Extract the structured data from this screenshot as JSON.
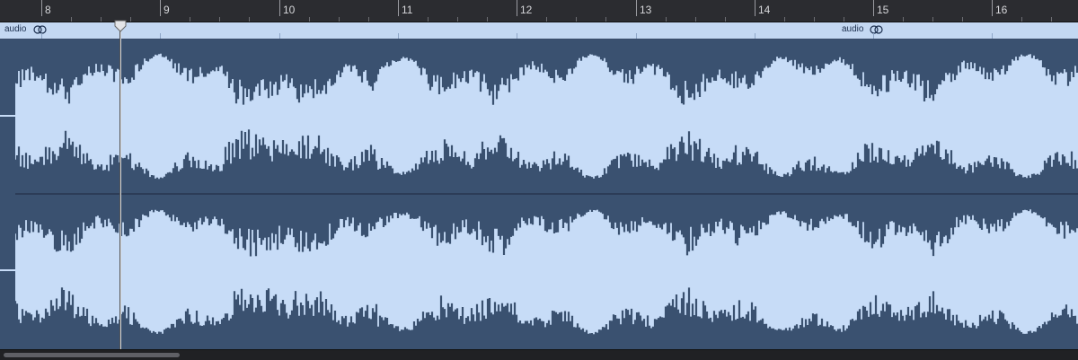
{
  "ruler": {
    "bars": [
      "8",
      "9",
      "10",
      "11",
      "12",
      "13",
      "14",
      "15",
      "16"
    ]
  },
  "regions": [
    {
      "name": "audio",
      "icon": "loop-icon"
    },
    {
      "name": "audio",
      "icon": "loop-icon"
    }
  ],
  "waveform": {
    "channels": 2,
    "color": "#3a5170",
    "background": "#c7dcf7"
  },
  "playhead": {
    "bar_position": 8.62
  },
  "colors": {
    "ruler_bg": "#2b2c30",
    "ruler_text": "#d6d7da",
    "region_bg": "#c7dcf7",
    "waveform_fill": "#3a5170",
    "scrollbar_thumb": "#5f6066"
  }
}
